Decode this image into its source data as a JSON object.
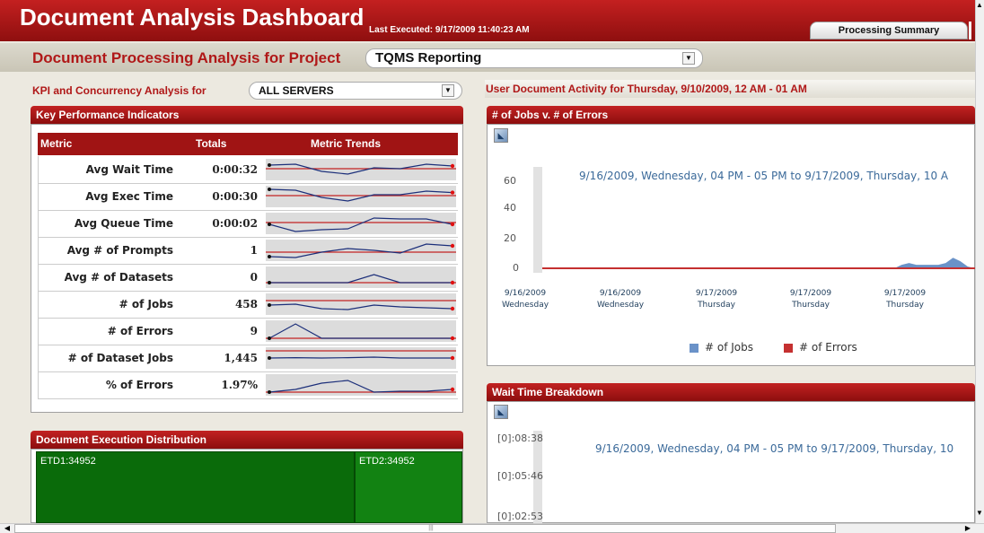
{
  "header": {
    "title": "Document Analysis Dashboard",
    "last_executed": "Last Executed: 9/17/2009 11:40:23 AM",
    "processing_summary_button": "Processing Summary"
  },
  "project": {
    "label": "Document Processing Analysis for Project",
    "selected": "TQMS Reporting"
  },
  "kpi_filter": {
    "label": "KPI and Concurrency Analysis for",
    "selected": "ALL SERVERS"
  },
  "user_activity_title": "User Document Activity for Thursday, 9/10/2009, 12 AM - 01 AM",
  "kpi_panel": {
    "title": "Key Performance Indicators",
    "columns": [
      "Metric",
      "Totals",
      "Metric Trends"
    ],
    "rows": [
      {
        "metric": "Avg Wait Time",
        "total": "0:00:32",
        "trend": [
          0.75,
          0.8,
          0.4,
          0.25,
          0.6,
          0.55,
          0.8,
          0.7
        ],
        "ref": 0.55
      },
      {
        "metric": "Avg Exec Time",
        "total": "0:00:30",
        "trend": [
          0.9,
          0.85,
          0.45,
          0.25,
          0.6,
          0.6,
          0.8,
          0.72
        ],
        "ref": 0.55
      },
      {
        "metric": "Avg Queue Time",
        "total": "0:00:02",
        "trend": [
          0.45,
          0.05,
          0.15,
          0.2,
          0.8,
          0.75,
          0.75,
          0.45
        ],
        "ref": 0.55
      },
      {
        "metric": "Avg # of Prompts",
        "total": "1",
        "trend": [
          0.15,
          0.1,
          0.4,
          0.6,
          0.5,
          0.35,
          0.85,
          0.75
        ],
        "ref": 0.4
      },
      {
        "metric": "Avg # of Datasets",
        "total": "0",
        "trend": [
          0.2,
          0.2,
          0.2,
          0.2,
          0.65,
          0.2,
          0.2,
          0.2
        ],
        "ref": 0.2
      },
      {
        "metric": "# of Jobs",
        "total": "458",
        "trend": [
          0.45,
          0.5,
          0.25,
          0.2,
          0.45,
          0.35,
          0.3,
          0.25
        ],
        "ref": 0.7
      },
      {
        "metric": "# of Errors",
        "total": "9",
        "trend": [
          0.1,
          0.9,
          0.1,
          0.1,
          0.1,
          0.1,
          0.1,
          0.1
        ],
        "ref": 0.1
      },
      {
        "metric": "# of Dataset Jobs",
        "total": "1,445",
        "trend": [
          0.5,
          0.52,
          0.5,
          0.52,
          0.55,
          0.5,
          0.5,
          0.5
        ],
        "ref": 0.9
      },
      {
        "metric": "% of Errors",
        "total": "1.97%",
        "trend": [
          0.1,
          0.25,
          0.6,
          0.75,
          0.1,
          0.15,
          0.15,
          0.25
        ],
        "ref": 0.1
      }
    ]
  },
  "distribution_panel": {
    "title": "Document Execution Distribution",
    "cells": [
      "ETD1:34952",
      "ETD2:34952"
    ]
  },
  "jobs_chart": {
    "title": "# of Jobs v. # of Errors",
    "date_range": "9/16/2009, Wednesday, 04 PM - 05 PM to 9/17/2009, Thursday, 10 A",
    "yticks": [
      "60",
      "40",
      "20",
      "0"
    ],
    "xticks": [
      {
        "date": "9/16/2009",
        "day": "Wednesday"
      },
      {
        "date": "9/16/2009",
        "day": "Wednesday"
      },
      {
        "date": "9/17/2009",
        "day": "Thursday"
      },
      {
        "date": "9/17/2009",
        "day": "Thursday"
      },
      {
        "date": "9/17/2009",
        "day": "Thursday"
      }
    ],
    "legend": [
      "# of Jobs",
      "# of Errors"
    ]
  },
  "chart_data": {
    "type": "area",
    "series": [
      {
        "name": "# of Jobs",
        "values": [
          0,
          0,
          0,
          0,
          0,
          0,
          0,
          0,
          0,
          0,
          0,
          0,
          0,
          0,
          0,
          0,
          0,
          0,
          0,
          0,
          0,
          0,
          0,
          0,
          0,
          0,
          0,
          0,
          0,
          0,
          0,
          0,
          0,
          0,
          0,
          0,
          0,
          0,
          0,
          0,
          0,
          0,
          0,
          0,
          0,
          0,
          0,
          0,
          0,
          2,
          3,
          2,
          2,
          2,
          2,
          3,
          6,
          4,
          1,
          0
        ]
      },
      {
        "name": "# of Errors",
        "values": [
          0,
          0,
          0,
          0,
          0,
          0,
          0,
          0,
          0,
          0,
          0,
          0,
          0,
          0,
          0,
          0,
          0,
          0,
          0,
          0,
          0,
          0,
          0,
          0,
          0,
          0,
          0,
          0,
          0,
          0,
          0,
          0,
          0,
          0,
          0,
          0,
          0,
          0,
          0,
          0,
          0,
          0,
          0,
          0,
          0,
          0,
          0,
          0,
          0,
          0,
          0,
          0,
          0,
          0,
          0,
          0,
          0,
          0,
          0,
          0
        ]
      }
    ],
    "ylim": [
      0,
      60
    ],
    "colors": {
      "jobs": "#6a92c8",
      "errors": "#c53030"
    }
  },
  "wait_chart": {
    "title": "Wait Time Breakdown",
    "date_range": "9/16/2009, Wednesday, 04 PM - 05 PM to 9/17/2009, Thursday, 10",
    "yticks": [
      "[0]:08:38",
      "[0]:05:46",
      "[0]:02:53"
    ]
  }
}
